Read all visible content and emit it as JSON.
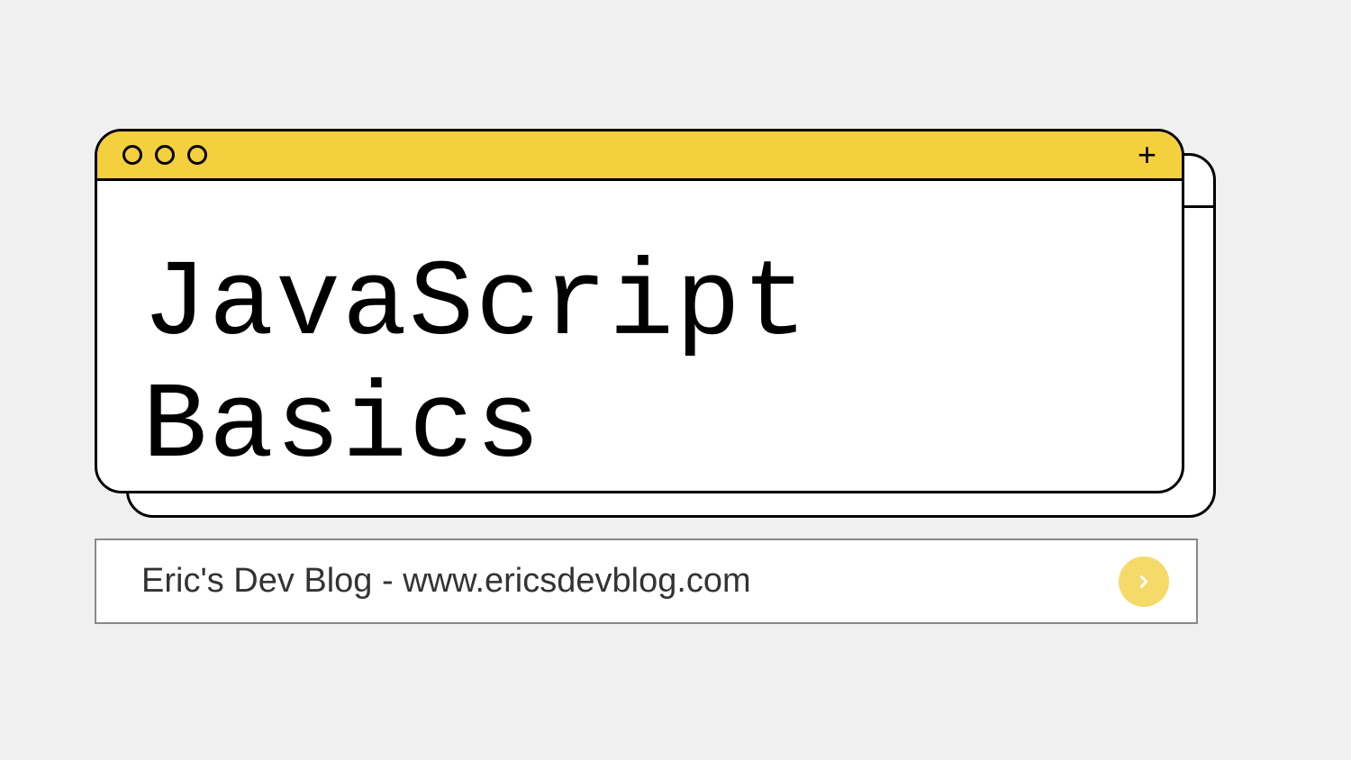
{
  "window": {
    "heading": "JavaScript Basics"
  },
  "addressBar": {
    "text": "Eric's Dev Blog - www.ericsdevblog.com"
  },
  "colors": {
    "titleBar": "#f4d03f",
    "background": "#f0f0f0",
    "goButton": "#f5da6a"
  }
}
